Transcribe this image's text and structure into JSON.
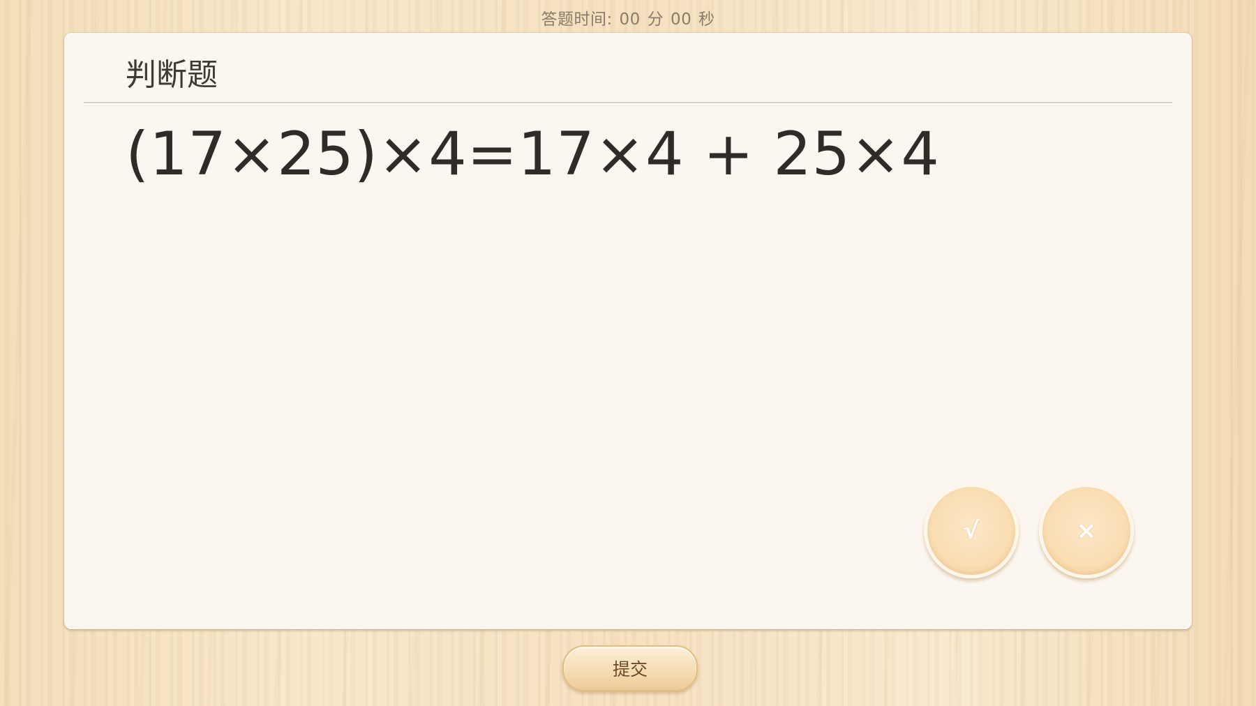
{
  "timer": {
    "label": "答题时间:",
    "minutes": "00",
    "minutes_unit": "分",
    "seconds": "00",
    "seconds_unit": "秒"
  },
  "question": {
    "type_title": "判断题",
    "text": "(17×25)×4=17×4 + 25×4"
  },
  "answers": {
    "true_label": "√",
    "false_label": "×"
  },
  "submit": {
    "label": "提交"
  },
  "colors": {
    "card_background": "#fbf6ef",
    "button_fill": "#f9ddb3",
    "text_dark": "#2f2b29"
  }
}
